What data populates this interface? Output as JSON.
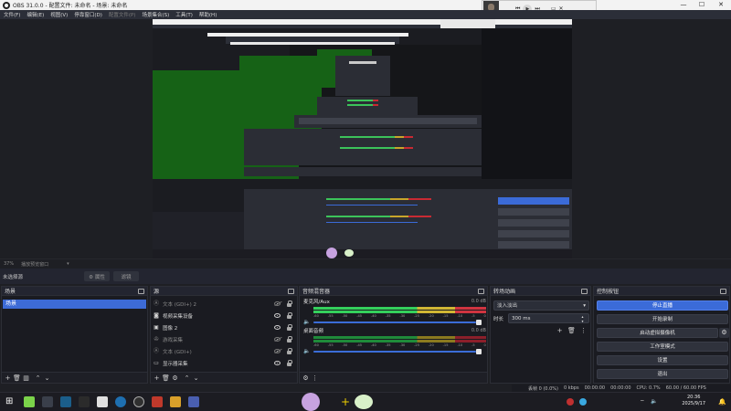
{
  "window": {
    "title": "OBS 31.0.0 - 配置文件: 未命名 - 场景: 未命名"
  },
  "menu": [
    "文件(F)",
    "编辑(E)",
    "视图(V)",
    "停靠窗口(D)",
    "配置文件(P)",
    "场景集合(S)",
    "工具(T)",
    "帮助(H)"
  ],
  "menu_disabled": [
    false,
    false,
    false,
    false,
    true,
    false,
    false,
    false
  ],
  "status_line": {
    "zoom": "37%",
    "label": "播放预览窗口"
  },
  "toolbar": {
    "no_source": "未选择源",
    "properties": "⚙ 属性",
    "filters": "滤镜"
  },
  "scenes": {
    "title": "场景",
    "items": [
      "场景"
    ]
  },
  "sources": {
    "title": "源",
    "items": [
      {
        "name": "文本 (GDI+) 2",
        "icon": "text-icon",
        "visible": false,
        "dim": true
      },
      {
        "name": "视频采集设备",
        "icon": "camera-icon",
        "visible": true,
        "dim": false
      },
      {
        "name": "图像 2",
        "icon": "image-icon",
        "visible": true,
        "dim": false
      },
      {
        "name": "游戏采集",
        "icon": "gamepad-icon",
        "visible": false,
        "dim": true
      },
      {
        "name": "文本 (GDI+)",
        "icon": "text-icon",
        "visible": false,
        "dim": true
      },
      {
        "name": "显示器采集",
        "icon": "monitor-icon",
        "visible": true,
        "dim": false
      }
    ]
  },
  "mixer": {
    "title": "音频混音器",
    "tracks": [
      {
        "name": "麦克风/Aux",
        "db": "0.0 dB"
      },
      {
        "name": "桌面音频",
        "db": "0.0 dB"
      }
    ],
    "scale": [
      "-60",
      "-55",
      "-50",
      "-45",
      "-40",
      "-35",
      "-30",
      "-25",
      "-20",
      "-15",
      "-10",
      "-5",
      "0"
    ]
  },
  "transitions": {
    "title": "转场动画",
    "selected": "淡入淡出",
    "duration_label": "时长",
    "duration": "300 ms"
  },
  "controls": {
    "title": "控制按钮",
    "buttons": [
      "停止直播",
      "开始录制",
      "启动虚拟摄像机",
      "工作室模式",
      "设置",
      "退出"
    ]
  },
  "statusbar": {
    "dropped": "丢帧 0 (0.0%)",
    "kbps": "0 kbps",
    "rec_time": "00:00:00",
    "stream_time": "00:00:00",
    "cpu": "CPU: 0.7%",
    "fps": "60.00 / 60.00 FPS"
  },
  "clock": {
    "time": "20:36",
    "date": "2025/9/17"
  },
  "media": {
    "prev": "⏮",
    "play": "▶",
    "next": "⏭"
  },
  "colors": {
    "accent": "#3b6bd8",
    "green_screen": "#166216",
    "meter_green": "#34d05c",
    "meter_red": "#d03440"
  }
}
